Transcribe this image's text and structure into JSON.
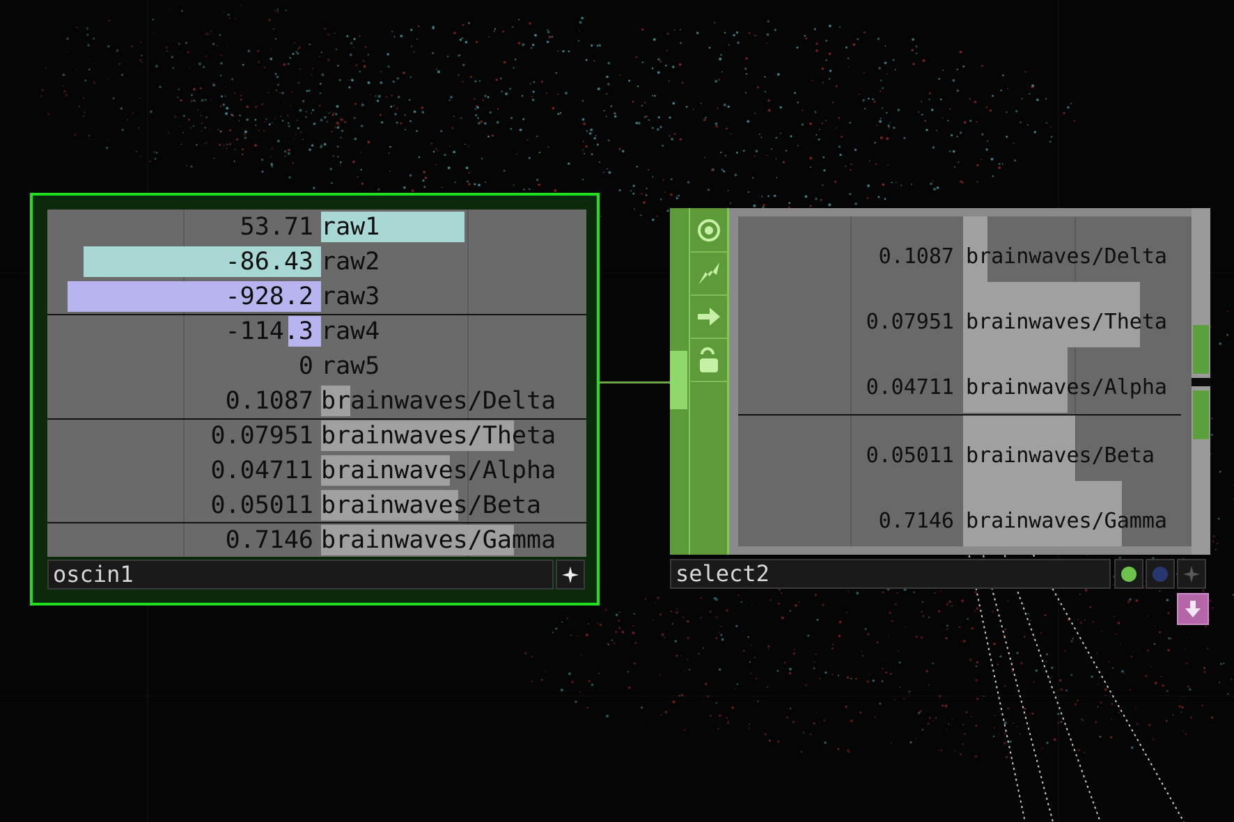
{
  "colors": {
    "background": "#050505",
    "selected_border": "#1fe01f",
    "node_side_green": "#5c9a3a",
    "bar_cyan": "#a8d8d4",
    "bar_lavender": "#b8b4f0",
    "bar_grey": "#a0a0a0",
    "output_button": "#b466a8"
  },
  "oscin1": {
    "name": "oscin1",
    "channels": [
      {
        "value": "53.71",
        "name": "raw1"
      },
      {
        "value": "-86.43",
        "name": "raw2"
      },
      {
        "value": "-928.2",
        "name": "raw3"
      },
      {
        "value": "-114.3",
        "name": "raw4"
      },
      {
        "value": "0",
        "name": "raw5"
      },
      {
        "value": "0.1087",
        "name": "brainwaves/Delta"
      },
      {
        "value": "0.07951",
        "name": "brainwaves/Theta"
      },
      {
        "value": "0.04711",
        "name": "brainwaves/Alpha"
      },
      {
        "value": "0.05011",
        "name": "brainwaves/Beta"
      },
      {
        "value": "0.7146",
        "name": "brainwaves/Gamma"
      }
    ],
    "icons": {
      "pin": "sparkle-icon"
    }
  },
  "select2": {
    "name": "select2",
    "channels": [
      {
        "value": "0.1087",
        "name": "brainwaves/Delta"
      },
      {
        "value": "0.07951",
        "name": "brainwaves/Theta"
      },
      {
        "value": "0.04711",
        "name": "brainwaves/Alpha"
      },
      {
        "value": "0.05011",
        "name": "brainwaves/Beta"
      },
      {
        "value": "0.7146",
        "name": "brainwaves/Gamma"
      }
    ],
    "side_icons": [
      "viewer-icon",
      "cook-icon",
      "bypass-arrow-icon",
      "lock-icon"
    ],
    "flags": [
      "green-dot-icon",
      "blue-dot-icon",
      "sparkle-icon"
    ],
    "output_icon": "down-arrow-icon"
  }
}
